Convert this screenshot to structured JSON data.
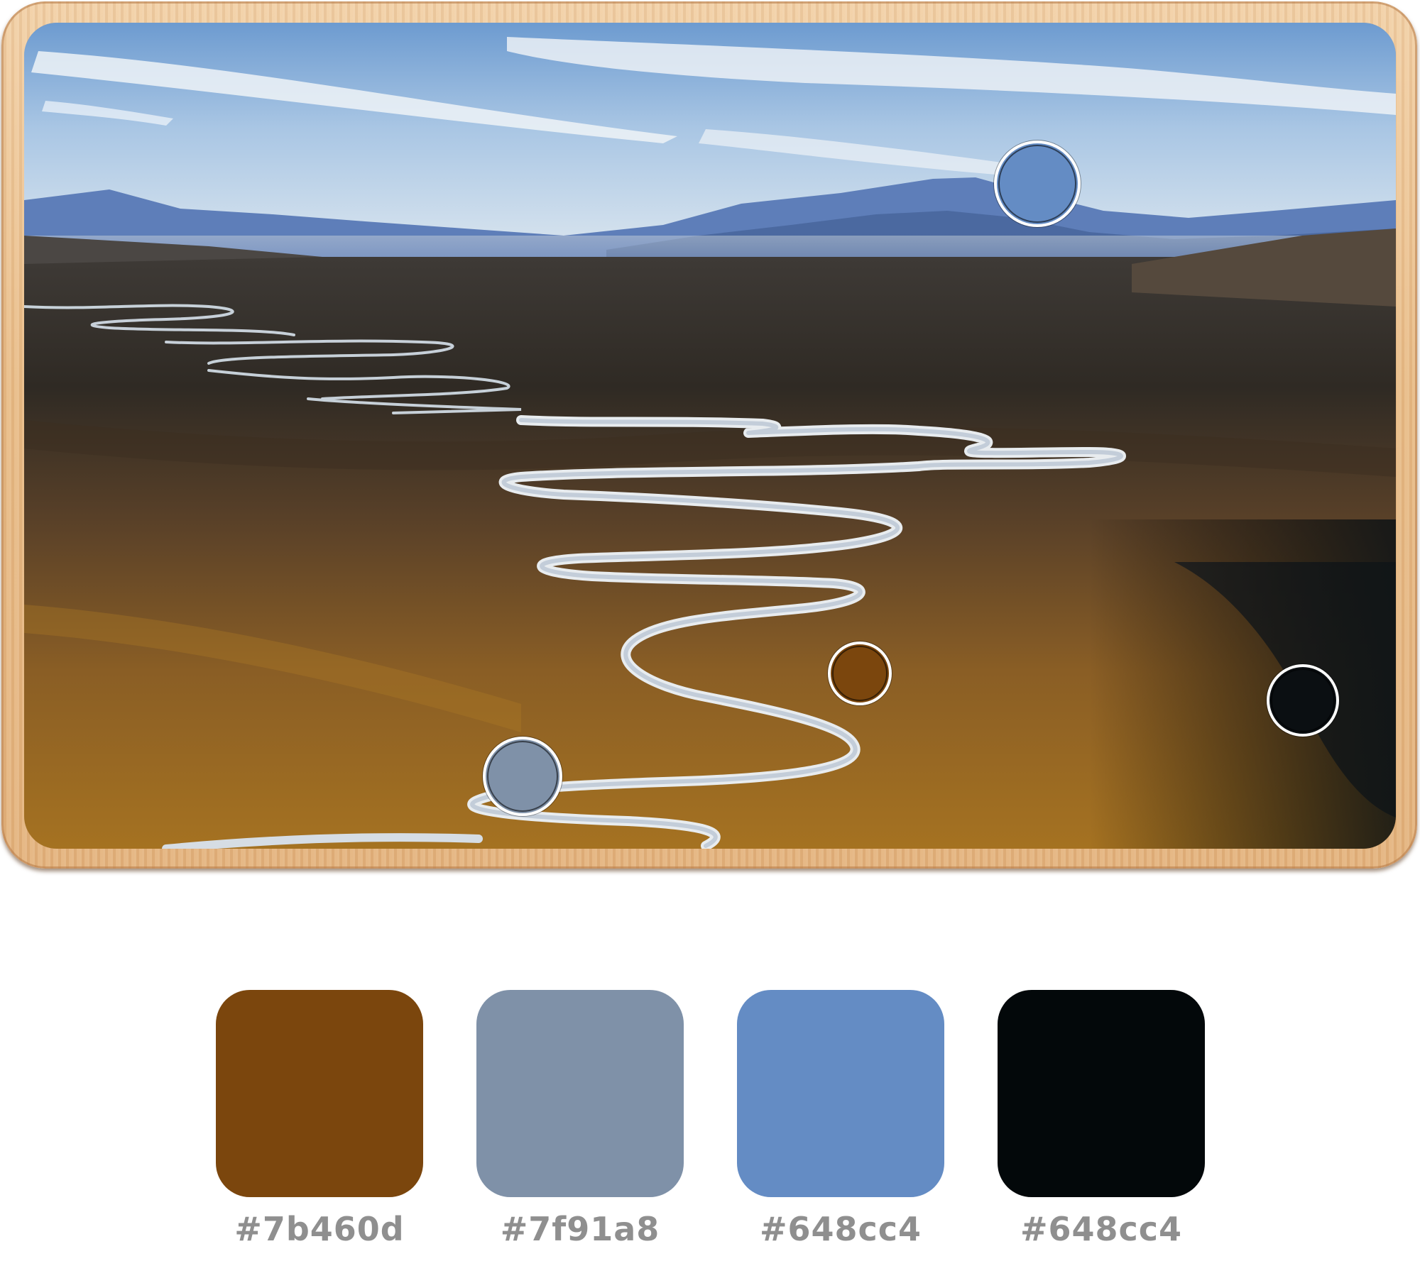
{
  "photo": {
    "subject": "mountain-valley-with-meandering-river"
  },
  "markers": [
    {
      "name": "sky-mountain-marker",
      "color": "#648cc4"
    },
    {
      "name": "plain-marker",
      "color": "#7b460d"
    },
    {
      "name": "river-marker",
      "color": "#7f91a8"
    },
    {
      "name": "shadow-marker",
      "color": "#0b0f12"
    }
  ],
  "palette": [
    {
      "color": "#7b460d",
      "label": "#7b460d"
    },
    {
      "color": "#7f91a8",
      "label": "#7f91a8"
    },
    {
      "color": "#648cc4",
      "label": "#648cc4"
    },
    {
      "color": "#03080a",
      "label": "#648cc4"
    }
  ]
}
